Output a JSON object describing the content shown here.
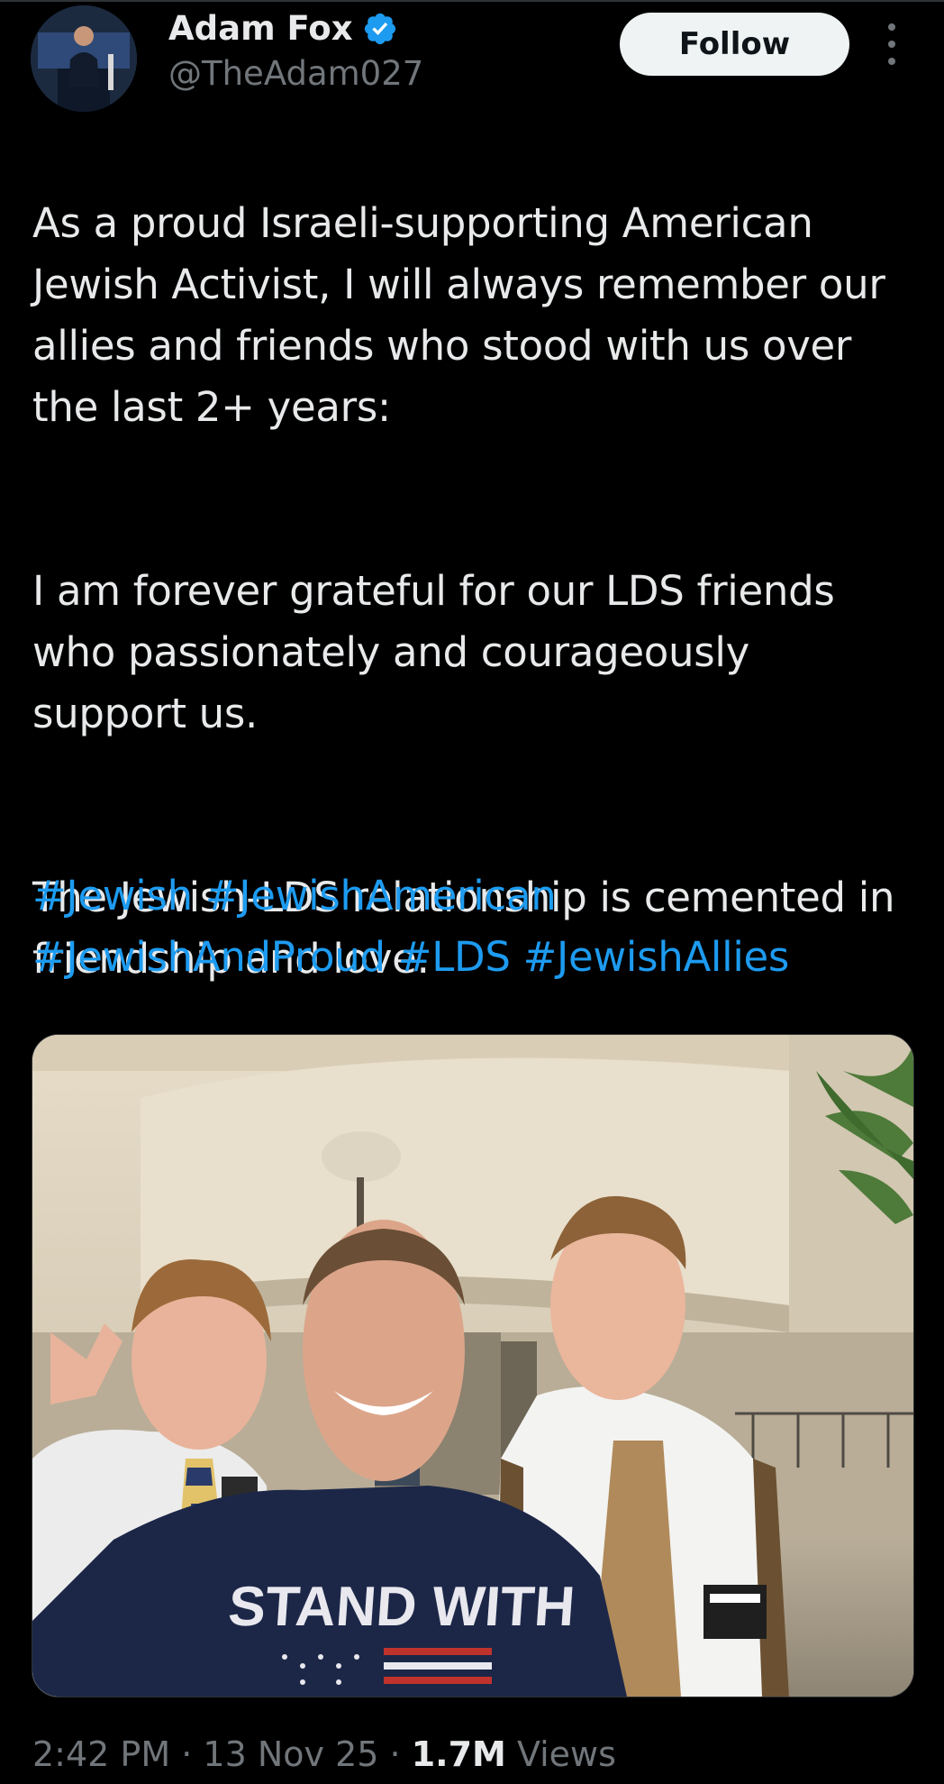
{
  "author": {
    "display_name": "Adam Fox",
    "handle": "@TheAdam027",
    "verified": true
  },
  "follow_button": {
    "label": "Follow"
  },
  "tweet": {
    "paragraphs": [
      "As a proud Israeli-supporting American Jewish Activist, I will always remember our allies and friends who stood with us over the last 2+ years:",
      "I am forever grateful for our LDS friends who passionately and courageously support us.",
      "The Jewish-LDS relationship is cemented in friendship and love."
    ],
    "hashtags": [
      "#Jewish",
      "#JewishAmerican",
      "#JewishAndProud",
      "#LDS",
      "#JewishAllies"
    ]
  },
  "photo": {
    "shirt_text": "STAND WITH"
  },
  "meta": {
    "time": "2:42 PM",
    "separator": "·",
    "date": "13 Nov 25",
    "views_count": "1.7M",
    "views_label": "Views"
  },
  "colors": {
    "background": "#000000",
    "text": "#e7e9ea",
    "secondary_text": "#71767b",
    "link": "#1d9bf0",
    "verified": "#1d9bf0",
    "follow_button_bg": "#eff3f4"
  },
  "icons": {
    "verified": "verified-badge-icon",
    "more": "more-options-icon"
  }
}
